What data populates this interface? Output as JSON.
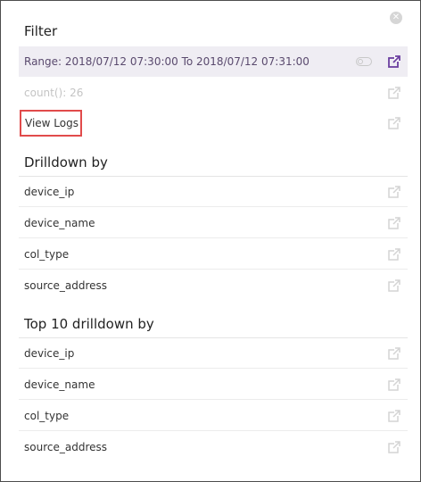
{
  "close_icon": "close-circle-icon",
  "filter": {
    "title": "Filter",
    "range_label": "Range: 2018/07/12 07:30:00 To 2018/07/12 07:31:00",
    "count_label": "count(): 26",
    "view_logs_label": "View Logs"
  },
  "drilldown": {
    "title": "Drilldown by",
    "items": [
      {
        "label": "device_ip"
      },
      {
        "label": "device_name"
      },
      {
        "label": "col_type"
      },
      {
        "label": "source_address"
      }
    ]
  },
  "top10": {
    "title": "Top 10 drilldown by",
    "items": [
      {
        "label": "device_ip"
      },
      {
        "label": "device_name"
      },
      {
        "label": "col_type"
      },
      {
        "label": "source_address"
      }
    ]
  },
  "colors": {
    "accent": "#6b3fa0",
    "range_bg": "#efedf3",
    "highlight_border": "#e14b4b",
    "icon_muted": "#d4d4d4"
  }
}
